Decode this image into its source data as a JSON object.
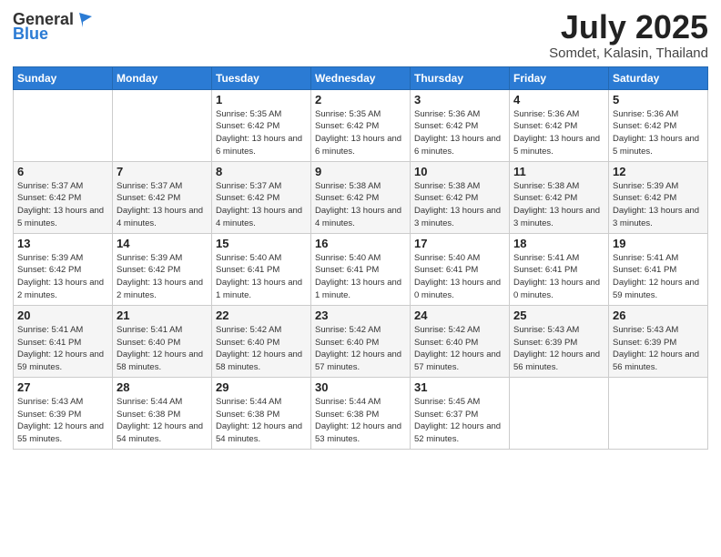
{
  "header": {
    "logo_general": "General",
    "logo_blue": "Blue",
    "month": "July 2025",
    "location": "Somdet, Kalasin, Thailand"
  },
  "weekdays": [
    "Sunday",
    "Monday",
    "Tuesday",
    "Wednesday",
    "Thursday",
    "Friday",
    "Saturday"
  ],
  "weeks": [
    [
      {
        "day": "",
        "info": ""
      },
      {
        "day": "",
        "info": ""
      },
      {
        "day": "1",
        "info": "Sunrise: 5:35 AM\nSunset: 6:42 PM\nDaylight: 13 hours and 6 minutes."
      },
      {
        "day": "2",
        "info": "Sunrise: 5:35 AM\nSunset: 6:42 PM\nDaylight: 13 hours and 6 minutes."
      },
      {
        "day": "3",
        "info": "Sunrise: 5:36 AM\nSunset: 6:42 PM\nDaylight: 13 hours and 6 minutes."
      },
      {
        "day": "4",
        "info": "Sunrise: 5:36 AM\nSunset: 6:42 PM\nDaylight: 13 hours and 5 minutes."
      },
      {
        "day": "5",
        "info": "Sunrise: 5:36 AM\nSunset: 6:42 PM\nDaylight: 13 hours and 5 minutes."
      }
    ],
    [
      {
        "day": "6",
        "info": "Sunrise: 5:37 AM\nSunset: 6:42 PM\nDaylight: 13 hours and 5 minutes."
      },
      {
        "day": "7",
        "info": "Sunrise: 5:37 AM\nSunset: 6:42 PM\nDaylight: 13 hours and 4 minutes."
      },
      {
        "day": "8",
        "info": "Sunrise: 5:37 AM\nSunset: 6:42 PM\nDaylight: 13 hours and 4 minutes."
      },
      {
        "day": "9",
        "info": "Sunrise: 5:38 AM\nSunset: 6:42 PM\nDaylight: 13 hours and 4 minutes."
      },
      {
        "day": "10",
        "info": "Sunrise: 5:38 AM\nSunset: 6:42 PM\nDaylight: 13 hours and 3 minutes."
      },
      {
        "day": "11",
        "info": "Sunrise: 5:38 AM\nSunset: 6:42 PM\nDaylight: 13 hours and 3 minutes."
      },
      {
        "day": "12",
        "info": "Sunrise: 5:39 AM\nSunset: 6:42 PM\nDaylight: 13 hours and 3 minutes."
      }
    ],
    [
      {
        "day": "13",
        "info": "Sunrise: 5:39 AM\nSunset: 6:42 PM\nDaylight: 13 hours and 2 minutes."
      },
      {
        "day": "14",
        "info": "Sunrise: 5:39 AM\nSunset: 6:42 PM\nDaylight: 13 hours and 2 minutes."
      },
      {
        "day": "15",
        "info": "Sunrise: 5:40 AM\nSunset: 6:41 PM\nDaylight: 13 hours and 1 minute."
      },
      {
        "day": "16",
        "info": "Sunrise: 5:40 AM\nSunset: 6:41 PM\nDaylight: 13 hours and 1 minute."
      },
      {
        "day": "17",
        "info": "Sunrise: 5:40 AM\nSunset: 6:41 PM\nDaylight: 13 hours and 0 minutes."
      },
      {
        "day": "18",
        "info": "Sunrise: 5:41 AM\nSunset: 6:41 PM\nDaylight: 13 hours and 0 minutes."
      },
      {
        "day": "19",
        "info": "Sunrise: 5:41 AM\nSunset: 6:41 PM\nDaylight: 12 hours and 59 minutes."
      }
    ],
    [
      {
        "day": "20",
        "info": "Sunrise: 5:41 AM\nSunset: 6:41 PM\nDaylight: 12 hours and 59 minutes."
      },
      {
        "day": "21",
        "info": "Sunrise: 5:41 AM\nSunset: 6:40 PM\nDaylight: 12 hours and 58 minutes."
      },
      {
        "day": "22",
        "info": "Sunrise: 5:42 AM\nSunset: 6:40 PM\nDaylight: 12 hours and 58 minutes."
      },
      {
        "day": "23",
        "info": "Sunrise: 5:42 AM\nSunset: 6:40 PM\nDaylight: 12 hours and 57 minutes."
      },
      {
        "day": "24",
        "info": "Sunrise: 5:42 AM\nSunset: 6:40 PM\nDaylight: 12 hours and 57 minutes."
      },
      {
        "day": "25",
        "info": "Sunrise: 5:43 AM\nSunset: 6:39 PM\nDaylight: 12 hours and 56 minutes."
      },
      {
        "day": "26",
        "info": "Sunrise: 5:43 AM\nSunset: 6:39 PM\nDaylight: 12 hours and 56 minutes."
      }
    ],
    [
      {
        "day": "27",
        "info": "Sunrise: 5:43 AM\nSunset: 6:39 PM\nDaylight: 12 hours and 55 minutes."
      },
      {
        "day": "28",
        "info": "Sunrise: 5:44 AM\nSunset: 6:38 PM\nDaylight: 12 hours and 54 minutes."
      },
      {
        "day": "29",
        "info": "Sunrise: 5:44 AM\nSunset: 6:38 PM\nDaylight: 12 hours and 54 minutes."
      },
      {
        "day": "30",
        "info": "Sunrise: 5:44 AM\nSunset: 6:38 PM\nDaylight: 12 hours and 53 minutes."
      },
      {
        "day": "31",
        "info": "Sunrise: 5:45 AM\nSunset: 6:37 PM\nDaylight: 12 hours and 52 minutes."
      },
      {
        "day": "",
        "info": ""
      },
      {
        "day": "",
        "info": ""
      }
    ]
  ]
}
